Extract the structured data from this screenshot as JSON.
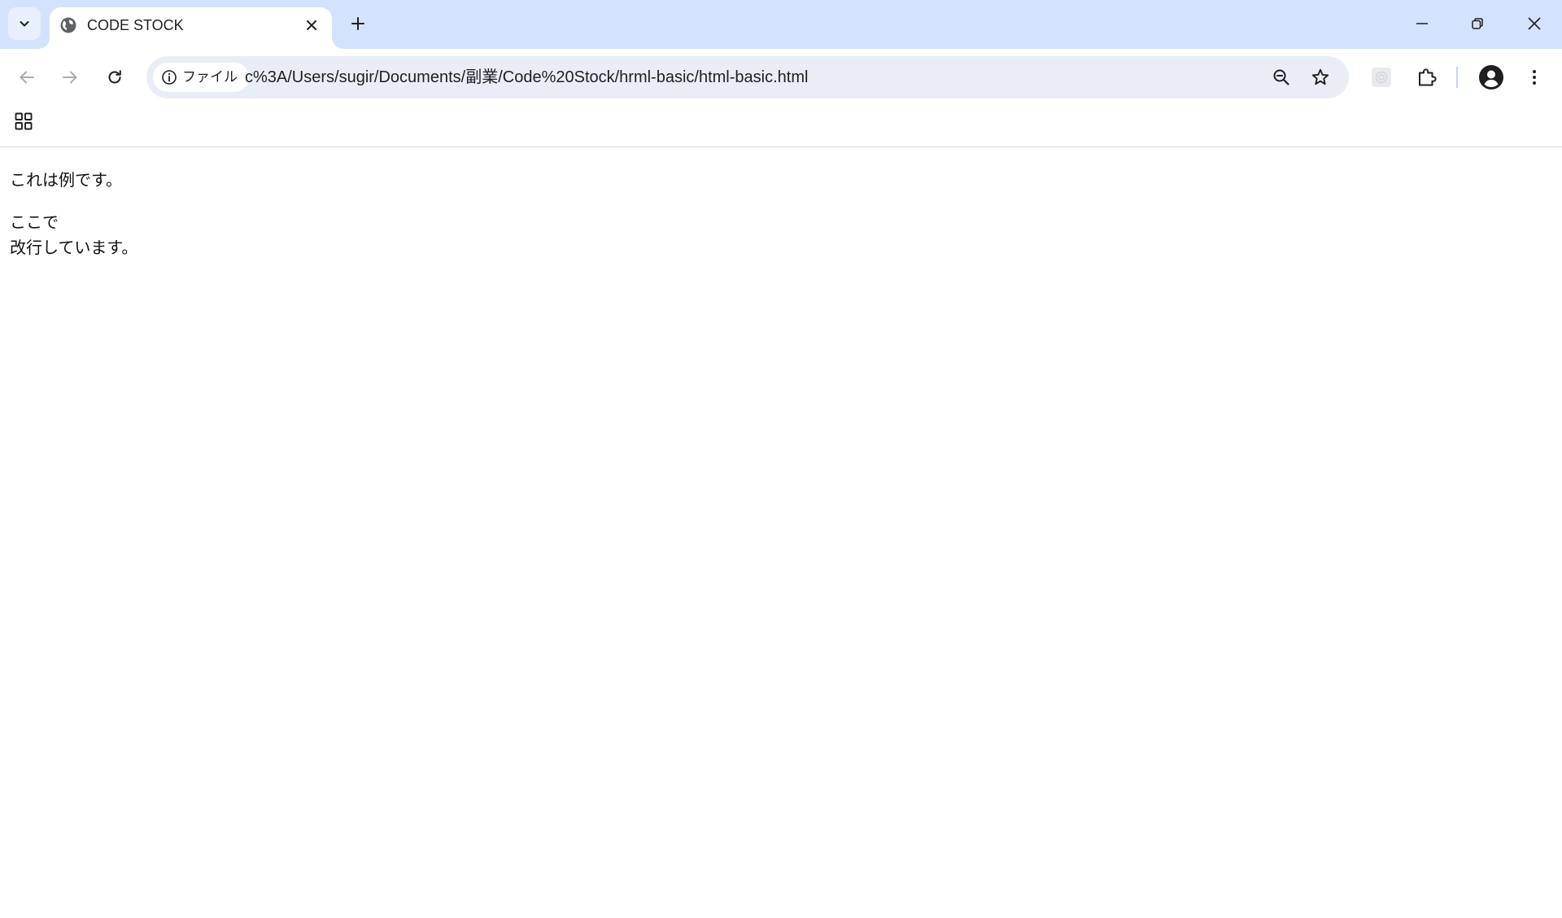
{
  "tab": {
    "title": "CODE STOCK"
  },
  "address_bar": {
    "site_info_label": "ファイル",
    "url": "c%3A/Users/sugir/Documents/副業/Code%20Stock/hrml-basic/html-basic.html"
  },
  "icons": {
    "tab_search": "chevron-down-icon",
    "favicon": "globe-icon",
    "tab_close": "close-icon",
    "new_tab": "plus-icon",
    "minimize": "minimize-icon",
    "restore": "restore-icon",
    "close_window": "close-icon",
    "back": "arrow-left-icon",
    "forward": "arrow-right-icon",
    "reload": "reload-icon",
    "site_info": "info-icon",
    "zoom": "zoom-out-icon",
    "bookmark": "star-icon",
    "extension_a": "extension-placeholder-icon",
    "extensions": "puzzle-icon",
    "profile": "account-circle-icon",
    "menu": "more-vertical-icon",
    "apps": "apps-grid-icon"
  },
  "colors": {
    "tabstrip": "#d3e3fd",
    "omnibox": "#e9eef6",
    "page_background": "#ffffff"
  },
  "page": {
    "paragraph_1": "これは例です。",
    "paragraph_2_line_1": "ここで",
    "paragraph_2_line_2": "改行しています。"
  }
}
